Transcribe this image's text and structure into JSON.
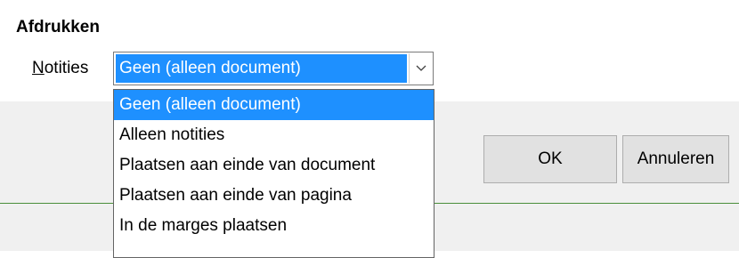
{
  "section": {
    "title": "Afdrukken"
  },
  "notes_field": {
    "label_first": "N",
    "label_rest": "otities",
    "value": "Geen (alleen document)"
  },
  "dropdown": {
    "options": [
      "Geen (alleen document)",
      "Alleen notities",
      "Plaatsen aan einde van document",
      "Plaatsen aan einde van pagina",
      "In de marges plaatsen"
    ],
    "selected_index": 0
  },
  "buttons": {
    "ok": "OK",
    "cancel": "Annuleren"
  },
  "colors": {
    "selection": "#1e90ff",
    "dialog_background": "#f0f0f0",
    "accent_line": "#4a8f3a"
  },
  "icons": {
    "combo_button": "chevron-down-icon"
  }
}
